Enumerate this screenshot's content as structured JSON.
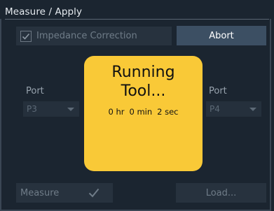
{
  "panel": {
    "title": "Measure / Apply"
  },
  "impedance": {
    "label": "Impedance Correction",
    "checked": true
  },
  "buttons": {
    "abort": "Abort",
    "measure": "Measure",
    "load": "Load..."
  },
  "port_left": {
    "label": "Port",
    "value": "P3"
  },
  "port_right": {
    "label": "Port",
    "value": "P4"
  },
  "progress_overlay": {
    "title_line1": "Running",
    "title_line2": "Tool...",
    "hours": "0 hr",
    "minutes": "0 min",
    "seconds": "2 sec"
  },
  "icons": {
    "checkbox": "check-icon",
    "measure_done": "check-icon",
    "dropdown": "chevron-down-icon"
  },
  "colors": {
    "background": "#1b2530",
    "overlay": "#f9c937",
    "abort_button": "#3c4f63"
  }
}
